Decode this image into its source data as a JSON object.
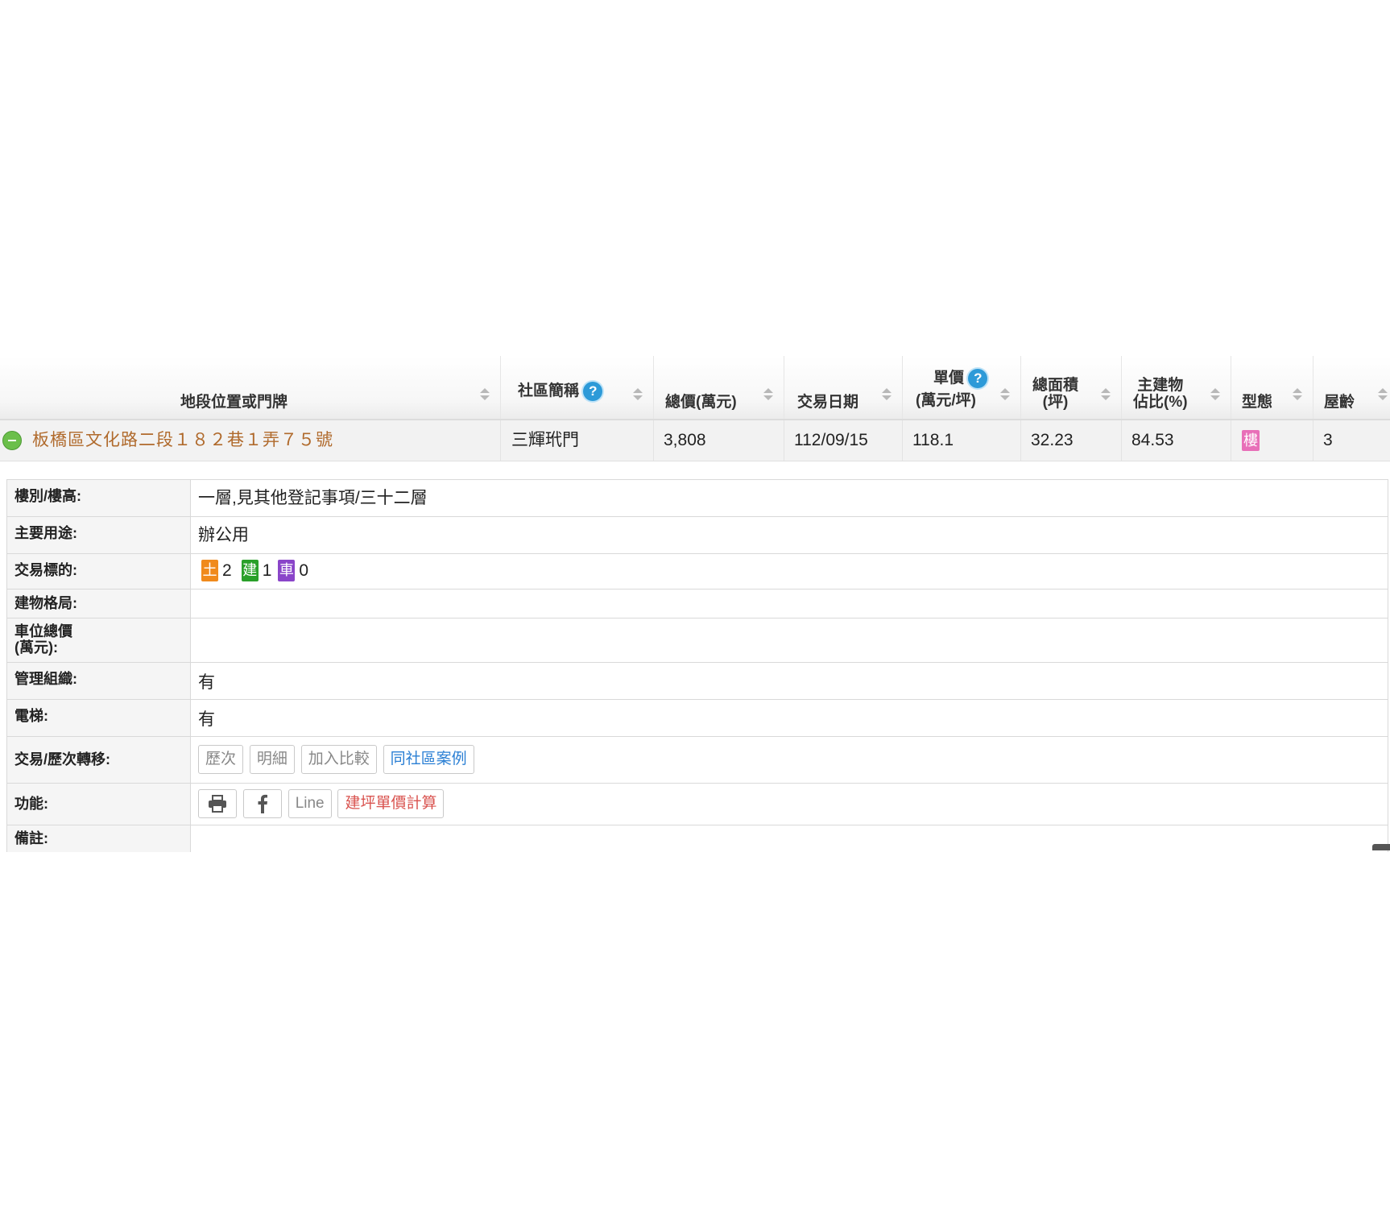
{
  "header": {
    "address": "地段位置或門牌",
    "community": "社區簡稱",
    "total_price": "總價(萬元)",
    "date": "交易日期",
    "unit_price_line1": "單價",
    "unit_price_line2": "(萬元/坪)",
    "area_line1": "總面積",
    "area_line2": "(坪)",
    "main_building_line1": "主建物",
    "main_building_line2": "佔比(%)",
    "type": "型態",
    "age": "屋齡",
    "help_glyph": "?"
  },
  "row": {
    "address": "板橋區文化路二段１８２巷１弄７５號",
    "community": "三輝玳門",
    "total_price": "3,808",
    "date": "112/09/15",
    "unit_price": "118.1",
    "area": "32.23",
    "main_building_ratio": "84.53",
    "type_badge": "樓",
    "age": "3"
  },
  "details": {
    "floor_label": "樓別/樓高:",
    "floor_value": "一層,見其他登記事項/三十二層",
    "use_label": "主要用途:",
    "use_value": "辦公用",
    "target_label": "交易標的:",
    "target_land_tag": "土",
    "target_land_count": "2",
    "target_build_tag": "建",
    "target_build_count": "1",
    "target_car_tag": "車",
    "target_car_count": "0",
    "layout_label": "建物格局:",
    "layout_value": "",
    "parking_label_line1": "車位總價",
    "parking_label_line2": "(萬元):",
    "parking_value": "",
    "mgmt_label": "管理組織:",
    "mgmt_value": "有",
    "elevator_label": "電梯:",
    "elevator_value": "有",
    "transfer_label": "交易/歷次轉移:",
    "transfer_buttons": [
      "歷次",
      "明細",
      "加入比較",
      "同社區案例"
    ],
    "function_label": "功能:",
    "function_line_button": "Line",
    "function_calc_button": "建坪單價計算",
    "remarks_label": "備註:"
  },
  "icons": {
    "help": "question-circle-icon",
    "collapse": "minus-circle-icon",
    "sort": "sort-arrows-icon",
    "print": "printer-icon",
    "facebook": "facebook-icon"
  },
  "colors": {
    "address_link": "#b06a2c",
    "help_blue": "#2d9ad8",
    "type_badge": "#e86fb8",
    "land_tag": "#f08a1c",
    "build_tag": "#2aa02a",
    "car_tag": "#8a45c9",
    "compare_link_blue": "#2a7fd4",
    "calc_red": "#d9534f"
  }
}
